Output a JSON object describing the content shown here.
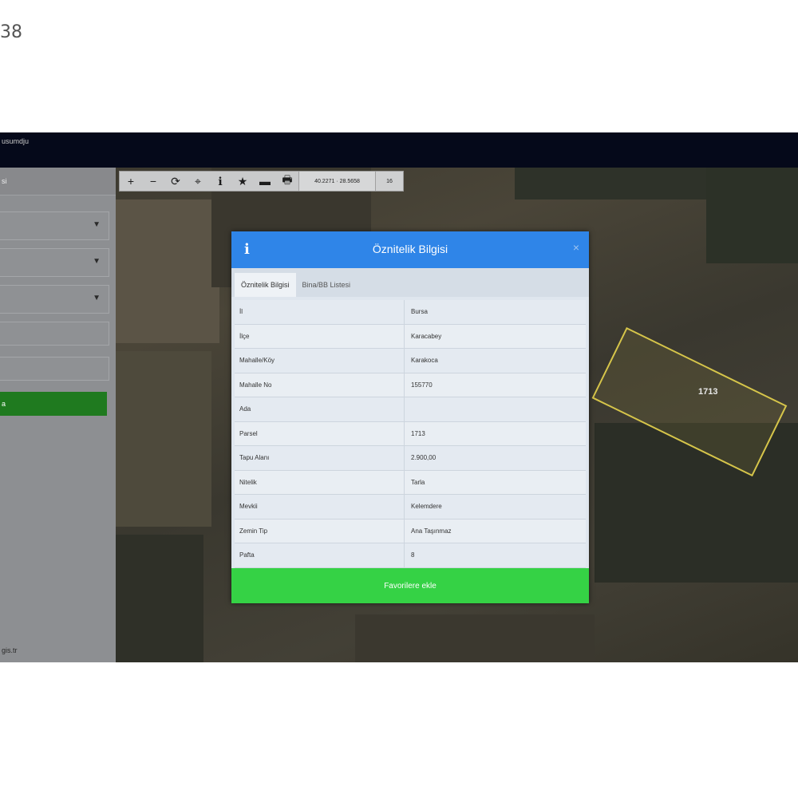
{
  "corner_text": "38",
  "app": {
    "title": "usumdju"
  },
  "sidebar": {
    "header": "si",
    "selects": [
      {
        "chevron": "chevron-down-icon"
      },
      {
        "chevron": "chevron-down-icon"
      },
      {
        "chevron": "chevron-down-icon"
      }
    ],
    "button_label": "a",
    "footer_text": "gis.tr"
  },
  "toolbar": {
    "buttons": [
      {
        "name": "zoom-in",
        "glyph": "+"
      },
      {
        "name": "zoom-out",
        "glyph": "−"
      },
      {
        "name": "refresh",
        "glyph": "⟳"
      },
      {
        "name": "locate",
        "glyph": "⌖"
      },
      {
        "name": "info",
        "glyph": "ℹ"
      },
      {
        "name": "favorite",
        "glyph": "★"
      },
      {
        "name": "measure",
        "glyph": "▬"
      },
      {
        "name": "print",
        "glyph": "🖶"
      }
    ],
    "coordinates": "40.2271 · 28.5658",
    "zoom_level": "16"
  },
  "map": {
    "parcel_label": "1713"
  },
  "dialog": {
    "title": "Öznitelik Bilgisi",
    "info_icon": "i",
    "close_icon": "×",
    "tabs": [
      "Öznitelik Bilgisi",
      "Bina/BB Listesi"
    ],
    "rows": [
      {
        "key": "İl",
        "value": "Bursa"
      },
      {
        "key": "İlçe",
        "value": "Karacabey"
      },
      {
        "key": "Mahalle/Köy",
        "value": "Karakoca"
      },
      {
        "key": "Mahalle No",
        "value": "155770"
      },
      {
        "key": "Ada",
        "value": ""
      },
      {
        "key": "Parsel",
        "value": "1713"
      },
      {
        "key": "Tapu Alanı",
        "value": "2.900,00"
      },
      {
        "key": "Nitelik",
        "value": "Tarla"
      },
      {
        "key": "Mevkii",
        "value": "Kelemdere"
      },
      {
        "key": "Zemin Tip",
        "value": "Ana Taşınmaz"
      },
      {
        "key": "Pafta",
        "value": "8"
      }
    ],
    "favorite_button": "Favorilere ekle"
  }
}
